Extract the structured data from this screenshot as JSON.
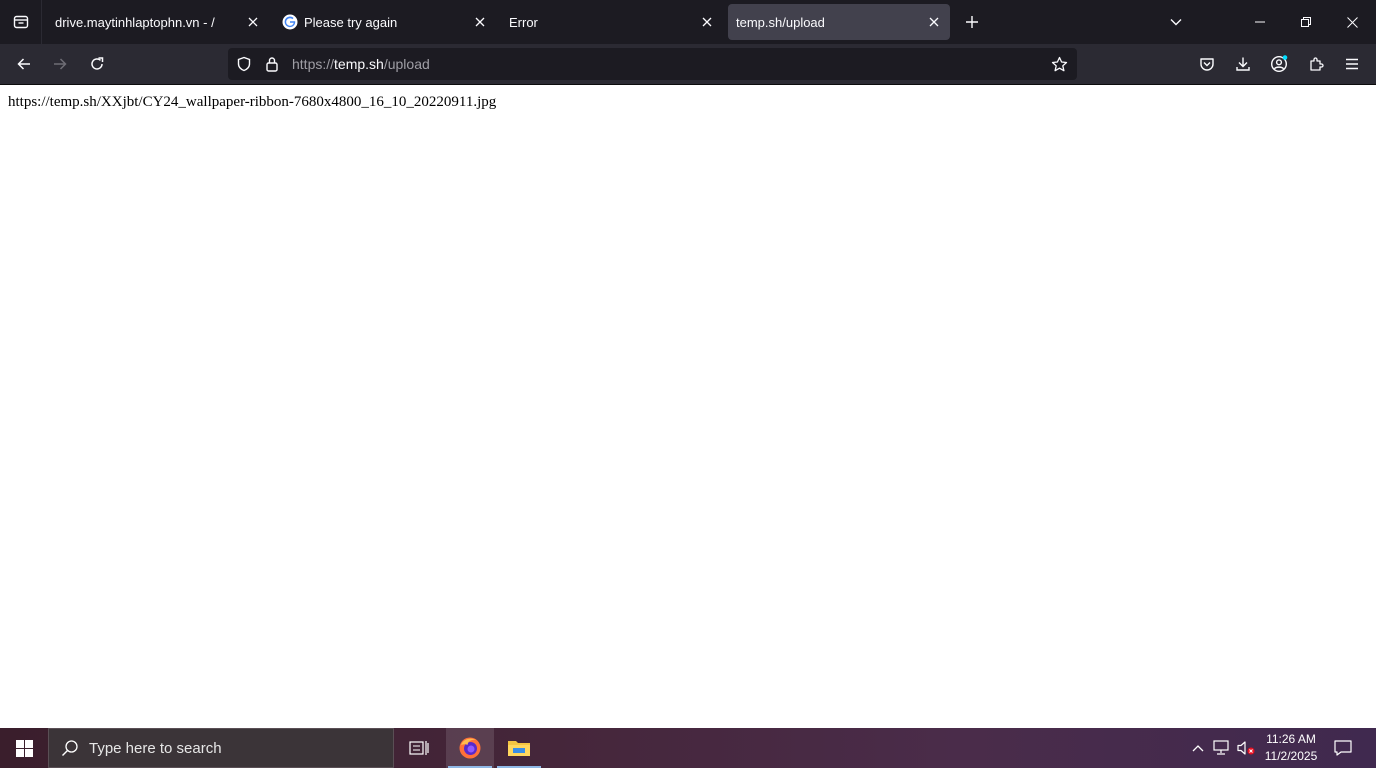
{
  "tabs": [
    {
      "title": "drive.maytinhlaptophn.vn - /",
      "active": false
    },
    {
      "title": "Please try again",
      "active": false,
      "favicon": "google-icon"
    },
    {
      "title": "Error",
      "active": false
    },
    {
      "title": "temp.sh/upload",
      "active": true
    }
  ],
  "urlbar": {
    "scheme": "https://",
    "host": "temp.sh",
    "path": "/upload"
  },
  "page": {
    "text": "https://temp.sh/XXjbt/CY24_wallpaper-ribbon-7680x4800_16_10_20220911.jpg"
  },
  "taskbar": {
    "search_placeholder": "Type here to search",
    "time": "11:26 AM",
    "date": "11/2/2025"
  },
  "colors": {
    "tabstrip": "#1c1b22",
    "toolbar": "#2b2a33",
    "active_tab": "#42414d",
    "accent": "#00ddff"
  }
}
